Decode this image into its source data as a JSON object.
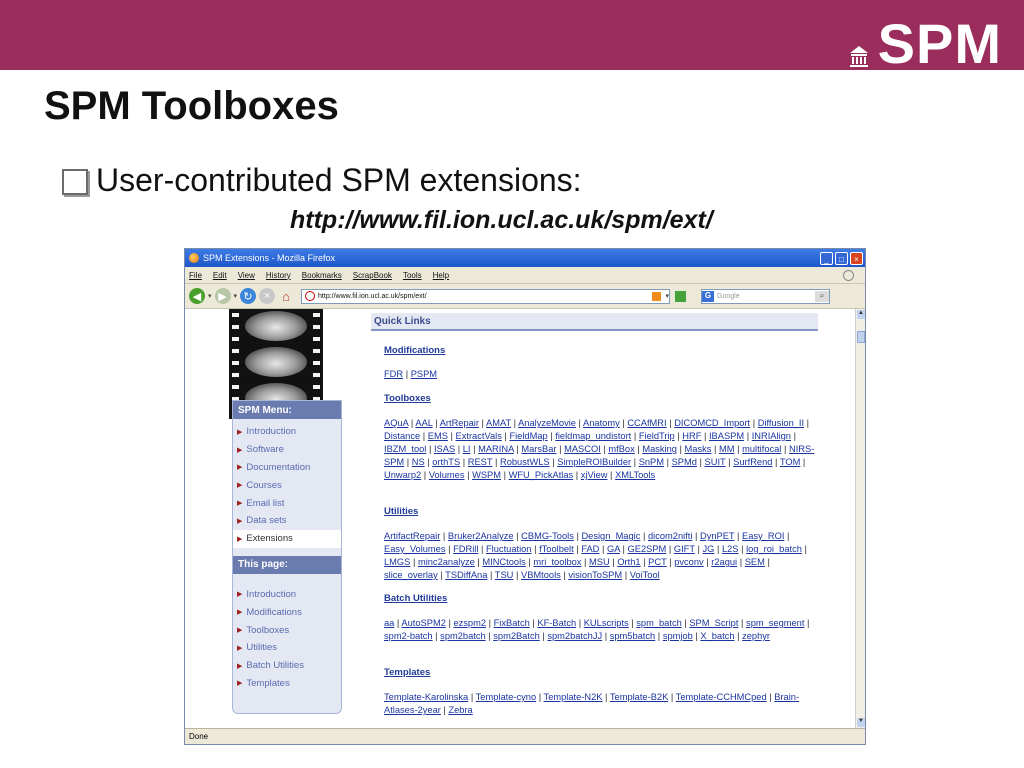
{
  "slide": {
    "title": "SPM Toolboxes",
    "bullet": "User-contributed SPM extensions:",
    "url": "http://www.fil.ion.ucl.ac.uk/spm/ext/",
    "logo_text": "SPM"
  },
  "browser": {
    "title": "SPM Extensions - Mozilla Firefox",
    "window_buttons": [
      "_",
      "□",
      "×"
    ],
    "menu": [
      "File",
      "Edit",
      "View",
      "History",
      "Bookmarks",
      "ScrapBook",
      "Tools",
      "Help"
    ],
    "address": "http://www.fil.ion.ucl.ac.uk/spm/ext/",
    "search_placeholder": "Google",
    "status": "Done"
  },
  "sidebar": {
    "menu_header": "SPM Menu:",
    "menu_items": [
      "Introduction",
      "Software",
      "Documentation",
      "Courses",
      "Email list",
      "Data sets",
      "Extensions"
    ],
    "page_header": "This page:",
    "page_items": [
      "Introduction",
      "Modifications",
      "Toolboxes",
      "Utilities",
      "Batch Utilities",
      "Templates"
    ]
  },
  "quick_links": {
    "header": "Quick Links",
    "modifications_title": "Modifications",
    "modifications": [
      "FDR",
      "PSPM"
    ],
    "toolboxes_title": "Toolboxes",
    "toolboxes": [
      "AQuA",
      "AAL",
      "ArtRepair",
      "AMAT",
      "AnalyzeMovie",
      "Anatomy",
      "CCAfMRI",
      "DICOMCD_Import",
      "Diffusion_II",
      "Distance",
      "EMS",
      "ExtractVals",
      "FieldMap",
      "fieldmap_undistort",
      "FieldTrip",
      "HRF",
      "IBASPM",
      "INRIAlign",
      "IBZM_tool",
      "ISAS",
      "LI",
      "MARINA",
      "MarsBar",
      "MASCOI",
      "mfBox",
      "Masking",
      "Masks",
      "MM",
      "multifocal",
      "NIRS-SPM",
      "NS",
      "orthTS",
      "REST",
      "RobustWLS",
      "SimpleROIBuilder",
      "SnPM",
      "SPMd",
      "SUIT",
      "SurfRend",
      "TOM",
      "Unwarp2",
      "Volumes",
      "WSPM",
      "WFU_PickAtlas",
      "xjView",
      "XMLTools"
    ],
    "utilities_title": "Utilities",
    "utilities": [
      "ArtifactRepair",
      "Bruker2Analyze",
      "CBMG-Tools",
      "Design_Magic",
      "dicom2nifti",
      "DynPET",
      "Easy_ROI",
      "Easy_Volumes",
      "FDRill",
      "Fluctuation",
      "fToolbelt",
      "FAD",
      "GA",
      "GE2SPM",
      "GIFT",
      "JG",
      "L2S",
      "log_roi_batch",
      "LMGS",
      "minc2analyze",
      "MINCtools",
      "mri_toolbox",
      "MSU",
      "Orth1",
      "PCT",
      "pvconv",
      "r2agui",
      "SEM",
      "slice_overlay",
      "TSDiffAna",
      "TSU",
      "VBMtools",
      "visionToSPM",
      "VoiTool"
    ],
    "batch_title": "Batch Utilities",
    "batch": [
      "aa",
      "AutoSPM2",
      "ezspm2",
      "FixBatch",
      "KF-Batch",
      "KULscripts",
      "spm_batch",
      "SPM_Script",
      "spm_segment",
      "spm2-batch",
      "spm2batch",
      "spm2Batch",
      "spm2batchJJ",
      "spm5batch",
      "spmjob",
      "X_batch",
      "zephyr"
    ],
    "templates_title": "Templates",
    "templates": [
      "Template-Karolinska",
      "Template-cyno",
      "Template-N2K",
      "Template-B2K",
      "Template-CCHMCped",
      "Brain-Atlases-2year",
      "Zebra"
    ]
  },
  "colors": {
    "banner": "#9b2d5c",
    "link": "#1b35a0",
    "menu_header": "#6a7bb0"
  }
}
